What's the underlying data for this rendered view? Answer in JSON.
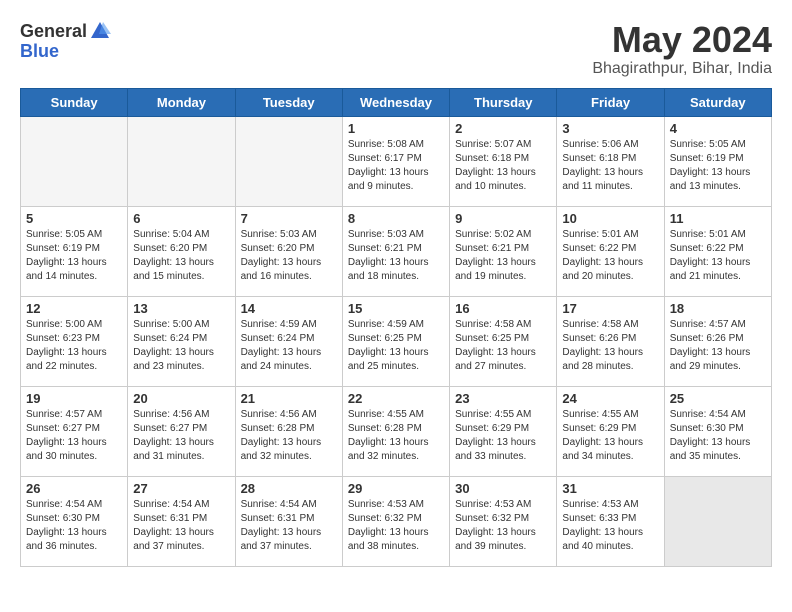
{
  "logo": {
    "general": "General",
    "blue": "Blue"
  },
  "title": "May 2024",
  "subtitle": "Bhagirathpur, Bihar, India",
  "days_of_week": [
    "Sunday",
    "Monday",
    "Tuesday",
    "Wednesday",
    "Thursday",
    "Friday",
    "Saturday"
  ],
  "weeks": [
    [
      {
        "day": "",
        "empty": true
      },
      {
        "day": "",
        "empty": true
      },
      {
        "day": "",
        "empty": true
      },
      {
        "day": "1",
        "sunrise": "Sunrise: 5:08 AM",
        "sunset": "Sunset: 6:17 PM",
        "daylight": "Daylight: 13 hours and 9 minutes."
      },
      {
        "day": "2",
        "sunrise": "Sunrise: 5:07 AM",
        "sunset": "Sunset: 6:18 PM",
        "daylight": "Daylight: 13 hours and 10 minutes."
      },
      {
        "day": "3",
        "sunrise": "Sunrise: 5:06 AM",
        "sunset": "Sunset: 6:18 PM",
        "daylight": "Daylight: 13 hours and 11 minutes."
      },
      {
        "day": "4",
        "sunrise": "Sunrise: 5:05 AM",
        "sunset": "Sunset: 6:19 PM",
        "daylight": "Daylight: 13 hours and 13 minutes."
      }
    ],
    [
      {
        "day": "5",
        "sunrise": "Sunrise: 5:05 AM",
        "sunset": "Sunset: 6:19 PM",
        "daylight": "Daylight: 13 hours and 14 minutes."
      },
      {
        "day": "6",
        "sunrise": "Sunrise: 5:04 AM",
        "sunset": "Sunset: 6:20 PM",
        "daylight": "Daylight: 13 hours and 15 minutes."
      },
      {
        "day": "7",
        "sunrise": "Sunrise: 5:03 AM",
        "sunset": "Sunset: 6:20 PM",
        "daylight": "Daylight: 13 hours and 16 minutes."
      },
      {
        "day": "8",
        "sunrise": "Sunrise: 5:03 AM",
        "sunset": "Sunset: 6:21 PM",
        "daylight": "Daylight: 13 hours and 18 minutes."
      },
      {
        "day": "9",
        "sunrise": "Sunrise: 5:02 AM",
        "sunset": "Sunset: 6:21 PM",
        "daylight": "Daylight: 13 hours and 19 minutes."
      },
      {
        "day": "10",
        "sunrise": "Sunrise: 5:01 AM",
        "sunset": "Sunset: 6:22 PM",
        "daylight": "Daylight: 13 hours and 20 minutes."
      },
      {
        "day": "11",
        "sunrise": "Sunrise: 5:01 AM",
        "sunset": "Sunset: 6:22 PM",
        "daylight": "Daylight: 13 hours and 21 minutes."
      }
    ],
    [
      {
        "day": "12",
        "sunrise": "Sunrise: 5:00 AM",
        "sunset": "Sunset: 6:23 PM",
        "daylight": "Daylight: 13 hours and 22 minutes."
      },
      {
        "day": "13",
        "sunrise": "Sunrise: 5:00 AM",
        "sunset": "Sunset: 6:24 PM",
        "daylight": "Daylight: 13 hours and 23 minutes."
      },
      {
        "day": "14",
        "sunrise": "Sunrise: 4:59 AM",
        "sunset": "Sunset: 6:24 PM",
        "daylight": "Daylight: 13 hours and 24 minutes."
      },
      {
        "day": "15",
        "sunrise": "Sunrise: 4:59 AM",
        "sunset": "Sunset: 6:25 PM",
        "daylight": "Daylight: 13 hours and 25 minutes."
      },
      {
        "day": "16",
        "sunrise": "Sunrise: 4:58 AM",
        "sunset": "Sunset: 6:25 PM",
        "daylight": "Daylight: 13 hours and 27 minutes."
      },
      {
        "day": "17",
        "sunrise": "Sunrise: 4:58 AM",
        "sunset": "Sunset: 6:26 PM",
        "daylight": "Daylight: 13 hours and 28 minutes."
      },
      {
        "day": "18",
        "sunrise": "Sunrise: 4:57 AM",
        "sunset": "Sunset: 6:26 PM",
        "daylight": "Daylight: 13 hours and 29 minutes."
      }
    ],
    [
      {
        "day": "19",
        "sunrise": "Sunrise: 4:57 AM",
        "sunset": "Sunset: 6:27 PM",
        "daylight": "Daylight: 13 hours and 30 minutes."
      },
      {
        "day": "20",
        "sunrise": "Sunrise: 4:56 AM",
        "sunset": "Sunset: 6:27 PM",
        "daylight": "Daylight: 13 hours and 31 minutes."
      },
      {
        "day": "21",
        "sunrise": "Sunrise: 4:56 AM",
        "sunset": "Sunset: 6:28 PM",
        "daylight": "Daylight: 13 hours and 32 minutes."
      },
      {
        "day": "22",
        "sunrise": "Sunrise: 4:55 AM",
        "sunset": "Sunset: 6:28 PM",
        "daylight": "Daylight: 13 hours and 32 minutes."
      },
      {
        "day": "23",
        "sunrise": "Sunrise: 4:55 AM",
        "sunset": "Sunset: 6:29 PM",
        "daylight": "Daylight: 13 hours and 33 minutes."
      },
      {
        "day": "24",
        "sunrise": "Sunrise: 4:55 AM",
        "sunset": "Sunset: 6:29 PM",
        "daylight": "Daylight: 13 hours and 34 minutes."
      },
      {
        "day": "25",
        "sunrise": "Sunrise: 4:54 AM",
        "sunset": "Sunset: 6:30 PM",
        "daylight": "Daylight: 13 hours and 35 minutes."
      }
    ],
    [
      {
        "day": "26",
        "sunrise": "Sunrise: 4:54 AM",
        "sunset": "Sunset: 6:30 PM",
        "daylight": "Daylight: 13 hours and 36 minutes."
      },
      {
        "day": "27",
        "sunrise": "Sunrise: 4:54 AM",
        "sunset": "Sunset: 6:31 PM",
        "daylight": "Daylight: 13 hours and 37 minutes."
      },
      {
        "day": "28",
        "sunrise": "Sunrise: 4:54 AM",
        "sunset": "Sunset: 6:31 PM",
        "daylight": "Daylight: 13 hours and 37 minutes."
      },
      {
        "day": "29",
        "sunrise": "Sunrise: 4:53 AM",
        "sunset": "Sunset: 6:32 PM",
        "daylight": "Daylight: 13 hours and 38 minutes."
      },
      {
        "day": "30",
        "sunrise": "Sunrise: 4:53 AM",
        "sunset": "Sunset: 6:32 PM",
        "daylight": "Daylight: 13 hours and 39 minutes."
      },
      {
        "day": "31",
        "sunrise": "Sunrise: 4:53 AM",
        "sunset": "Sunset: 6:33 PM",
        "daylight": "Daylight: 13 hours and 40 minutes."
      },
      {
        "day": "",
        "empty": true,
        "shaded": true
      }
    ]
  ]
}
